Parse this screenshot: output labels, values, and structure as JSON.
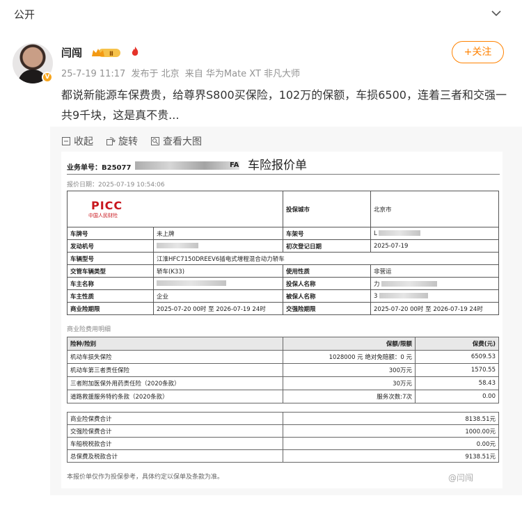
{
  "top": {
    "visibility": "公开",
    "chevron_icon": "chevron-down-icon"
  },
  "post": {
    "username": "闫闯",
    "vip_badge": "Ⅱ",
    "time": "25-7-19 11:17",
    "location": "发布于 北京",
    "source": "来自 华为Mate XT 非凡大师",
    "follow_label": "+关注",
    "verified_badge": "V",
    "text": "都说新能源车保费贵，给尊界S800买保险，102万的保额，车损6500，连着三者和交强一共9千块，这是真不贵..."
  },
  "tools": {
    "collect": "收起",
    "rotate": "旋转",
    "view_large": "查看大图"
  },
  "quote": {
    "bizno_prefix": "业务单号：B25077",
    "bizno_suffix": "FA",
    "title": "车险报价单",
    "quote_date": "报价日期：2025-07-19 10:54:06",
    "logo": "PICC",
    "logo_sub": "中国人民财险",
    "rows": {
      "insure_city_label": "投保城市",
      "insure_city": "北京市",
      "plate_label": "车牌号",
      "plate": "未上牌",
      "vin_label": "车架号",
      "vin": "L",
      "engine_label": "发动机号",
      "reg_date_label": "初次登记日期",
      "reg_date": "2025-07-19",
      "model_label": "车辆型号",
      "model": "江淮HFC7150DREEV6插电式增程混合动力轿车",
      "mgmt_type_label": "交管车辆类型",
      "mgmt_type": "轿车(K33)",
      "usage_label": "使用性质",
      "usage": "非营运",
      "owner_label": "车主名称",
      "applicant_label": "投保人名称",
      "applicant": "力",
      "owner_type_label": "车主性质",
      "owner_type": "企业",
      "insured_label": "被保人名称",
      "insured": "3",
      "biz_period_label": "商业险期限",
      "biz_period": "2025-07-20 00时 至 2026-07-19 24时",
      "cp_period_label": "交强险期限",
      "cp_period": "2025-07-20 00时 至 2026-07-19 24时"
    },
    "section_title": "商业险费用明细",
    "detail_head": {
      "kind": "险种/险别",
      "coverage": "保额/限额",
      "premium": "保费(元)"
    },
    "details": [
      {
        "kind": "机动车损失保险",
        "coverage": "1028000 元  绝对免赔额：0 元",
        "premium": "6509.53"
      },
      {
        "kind": "机动车第三者责任保险",
        "coverage": "300万元",
        "premium": "1570.55"
      },
      {
        "kind": "三者附加医保外用药责任险（2020条款）",
        "coverage": "30万元",
        "premium": "58.43"
      },
      {
        "kind": "道路救援服务特约条款（2020条款）",
        "coverage": "服务次数:7次",
        "premium": "0.00"
      }
    ],
    "totals": [
      {
        "label": "商业险保费合计",
        "value": "8138.51元"
      },
      {
        "label": "交强险保费合计",
        "value": "1000.00元"
      },
      {
        "label": "车船税税款合计",
        "value": "0.00元"
      },
      {
        "label": "总保费及税款合计",
        "value": "9138.51元"
      }
    ],
    "note": "本报价单仅作为投保参考，具体约定以保单及条款为准。",
    "watermark": "@闫闯"
  }
}
